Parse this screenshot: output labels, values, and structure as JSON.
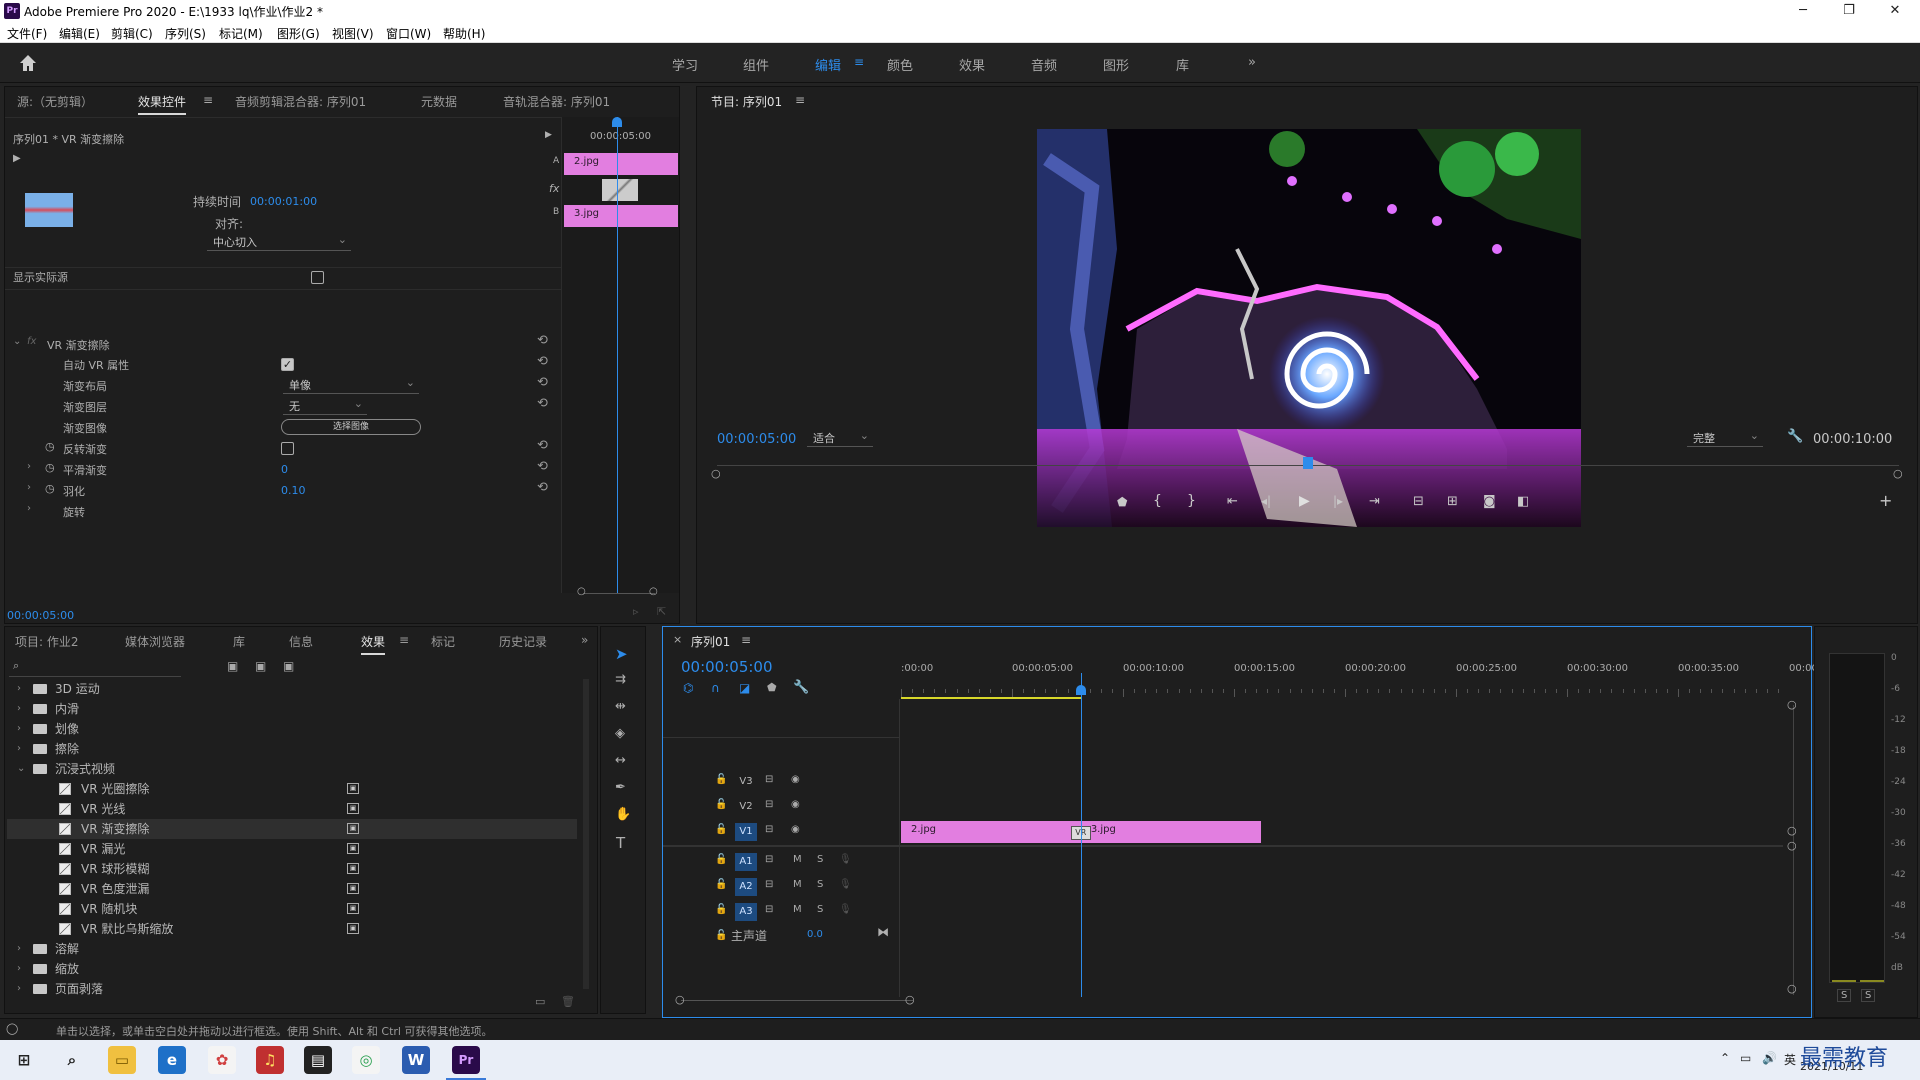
{
  "window": {
    "title": "Adobe Premiere Pro 2020 - E:\\1933 lq\\作业\\作业2 *",
    "logo": "Pr",
    "minimize": "─",
    "maximize": "❐",
    "close": "✕"
  },
  "menu": [
    "文件(F)",
    "编辑(E)",
    "剪辑(C)",
    "序列(S)",
    "标记(M)",
    "图形(G)",
    "视图(V)",
    "窗口(W)",
    "帮助(H)"
  ],
  "workspaces": [
    "学习",
    "组件",
    "编辑",
    "颜色",
    "效果",
    "音频",
    "图形",
    "库"
  ],
  "workspace_active": "编辑",
  "workspace_more": "»",
  "source_panel": {
    "tabs": [
      "源:（无剪辑）",
      "效果控件",
      "音频剪辑混合器: 序列01",
      "元数据",
      "音轨混合器: 序列01"
    ],
    "active_tab": "效果控件",
    "clip_header": "序列01 * VR 渐变擦除",
    "timeruler": "00:00:05:00",
    "clip_a": "2.jpg",
    "clip_b": "3.jpg",
    "label_a": "A",
    "label_b": "B",
    "duration_label": "持续时间",
    "duration_value": "00:00:01:00",
    "align_label": "对齐:",
    "align_value": "中心切入",
    "show_actual_source": "显示实际源",
    "effect_name": "VR 渐变擦除",
    "params": [
      {
        "label": "自动 VR 属性",
        "type": "checkbox",
        "checked": true
      },
      {
        "label": "渐变布局",
        "type": "dropdown",
        "value": "单像"
      },
      {
        "label": "渐变图层",
        "type": "dropdown",
        "value": "无"
      },
      {
        "label": "渐变图像",
        "type": "button",
        "value": "选择图像"
      },
      {
        "label": "反转渐变",
        "type": "checkbox",
        "checked": false
      },
      {
        "label": "平滑渐变",
        "type": "number",
        "value": "0"
      },
      {
        "label": "羽化",
        "type": "number",
        "value": "0.10"
      },
      {
        "label": "旋转",
        "type": "none",
        "value": ""
      }
    ],
    "footer_time": "00:00:05:00"
  },
  "program_panel": {
    "title": "节目: 序列01",
    "current_time": "00:00:05:00",
    "fit": "适合",
    "quality": "完整",
    "duration": "00:00:10:00",
    "playhead_fraction": 0.5
  },
  "project_panel": {
    "tabs": [
      "项目: 作业2",
      "媒体浏览器",
      "库",
      "信息",
      "效果",
      "标记",
      "历史记录"
    ],
    "active_tab": "效果",
    "items": [
      {
        "label": "3D 运动",
        "kind": "folder",
        "level": 0,
        "expanded": false
      },
      {
        "label": "内滑",
        "kind": "folder",
        "level": 0,
        "expanded": false
      },
      {
        "label": "划像",
        "kind": "folder",
        "level": 0,
        "expanded": false
      },
      {
        "label": "擦除",
        "kind": "folder",
        "level": 0,
        "expanded": false
      },
      {
        "label": "沉浸式视频",
        "kind": "folder",
        "level": 0,
        "expanded": true
      },
      {
        "label": "VR 光圈擦除",
        "kind": "effect",
        "level": 1
      },
      {
        "label": "VR 光线",
        "kind": "effect",
        "level": 1
      },
      {
        "label": "VR 渐变擦除",
        "kind": "effect",
        "level": 1,
        "selected": true
      },
      {
        "label": "VR 漏光",
        "kind": "effect",
        "level": 1
      },
      {
        "label": "VR 球形模糊",
        "kind": "effect",
        "level": 1
      },
      {
        "label": "VR 色度泄漏",
        "kind": "effect",
        "level": 1
      },
      {
        "label": "VR 随机块",
        "kind": "effect",
        "level": 1
      },
      {
        "label": "VR 默比乌斯缩放",
        "kind": "effect",
        "level": 1
      },
      {
        "label": "溶解",
        "kind": "folder",
        "level": 0,
        "expanded": false
      },
      {
        "label": "缩放",
        "kind": "folder",
        "level": 0,
        "expanded": false
      },
      {
        "label": "页面剥落",
        "kind": "folder",
        "level": 0,
        "expanded": false
      }
    ]
  },
  "timeline": {
    "title": "序列01",
    "current_time": "00:00:05:00",
    "ruler": [
      ":00:00",
      "00:00:05:00",
      "00:00:10:00",
      "00:00:15:00",
      "00:00:20:00",
      "00:00:25:00",
      "00:00:30:00",
      "00:00:35:00",
      "00:0C"
    ],
    "video_tracks": [
      "V3",
      "V2",
      "V1"
    ],
    "audio_tracks": [
      "A1",
      "A2",
      "A3"
    ],
    "master": "主声道",
    "master_value": "0.0",
    "mute": "M",
    "solo": "S",
    "clips": [
      {
        "name": "2.jpg",
        "start": 0,
        "end": 5
      },
      {
        "name": "3.jpg",
        "start": 5,
        "end": 10
      }
    ],
    "transition_label": "VR"
  },
  "meter": {
    "labels": [
      "0",
      "-6",
      "-12",
      "-18",
      "-24",
      "-30",
      "-36",
      "-42",
      "-48",
      "-54",
      "dB"
    ],
    "solo_buttons": [
      "S",
      "S"
    ]
  },
  "status": "单击以选择，或单击空白处并拖动以进行框选。使用 Shift、Alt 和 Ctrl 可获得其他选项。",
  "taskbar": {
    "ime": "英",
    "clock": "2021/10/11",
    "watermark": "最需教育"
  },
  "colors": {
    "accent": "#2d8ceb",
    "clip": "#e27ee0",
    "panel": "#1e1e1e"
  }
}
